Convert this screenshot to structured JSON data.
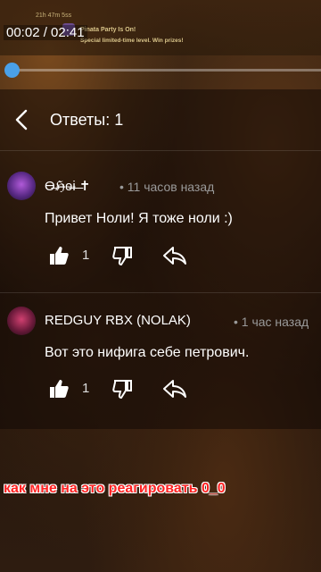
{
  "banner": {
    "time": "21h 47m 5ss",
    "title": "Pinata Party Is On!",
    "subtitle": "Special limited-time level. Win prizes!"
  },
  "player": {
    "time_display": "00:02 / 02:41",
    "progress": 0.0
  },
  "header": {
    "title": "Ответы: 1"
  },
  "comments": [
    {
      "author": "Ɵ̶ℌ̶ɵ̶ɨ̶ ̶̶✝",
      "time": "• 11 часов назад",
      "text": "Привет Ноли! Я тоже ноли :)",
      "likes": "1"
    },
    {
      "author": "REDGUY RBX (NOLAK)",
      "time": "• 1 час назад",
      "text": "Вот это нифига себе петрович.",
      "likes": "1"
    }
  ],
  "caption": "как мне на это реагировать 0_0",
  "colors": {
    "seek_accent": "#4aa0e8",
    "caption": "#ff2222"
  },
  "icons": [
    "back-arrow-icon",
    "thumbs-up-icon",
    "thumbs-down-icon",
    "reply-icon"
  ]
}
